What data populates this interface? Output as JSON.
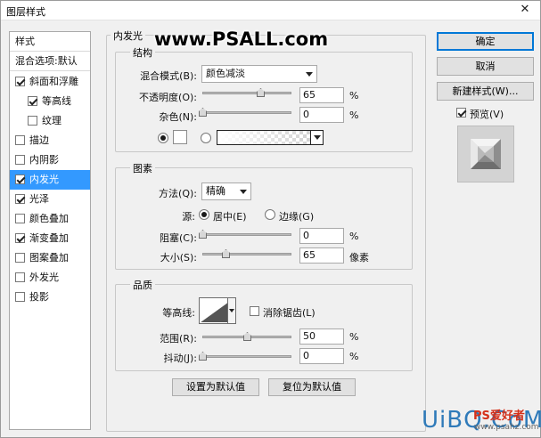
{
  "window": {
    "title": "图层样式",
    "close_glyph": "✕"
  },
  "styles_list": {
    "header": "样式",
    "blending_options": "混合选项:默认",
    "items": [
      {
        "label": "斜面和浮雕",
        "checked": true
      },
      {
        "label": "等高线",
        "checked": true
      },
      {
        "label": "纹理",
        "checked": false
      },
      {
        "label": "描边",
        "checked": false
      },
      {
        "label": "内阴影",
        "checked": false
      },
      {
        "label": "内发光",
        "checked": true,
        "selected": true
      },
      {
        "label": "光泽",
        "checked": true
      },
      {
        "label": "颜色叠加",
        "checked": false
      },
      {
        "label": "渐变叠加",
        "checked": true
      },
      {
        "label": "图案叠加",
        "checked": false
      },
      {
        "label": "外发光",
        "checked": false
      },
      {
        "label": "投影",
        "checked": false
      }
    ]
  },
  "panel": {
    "title": "内发光",
    "structure": {
      "title": "结构",
      "blend_mode_label": "混合模式(B):",
      "blend_mode_value": "颜色减淡",
      "opacity_label": "不透明度(O):",
      "opacity_value": "65",
      "opacity_unit": "%",
      "noise_label": "杂色(N):",
      "noise_value": "0",
      "noise_unit": "%"
    },
    "elements": {
      "title": "图素",
      "technique_label": "方法(Q):",
      "technique_value": "精确",
      "source_label": "源:",
      "source_center": "居中(E)",
      "source_edge": "边缘(G)",
      "choke_label": "阻塞(C):",
      "choke_value": "0",
      "choke_unit": "%",
      "size_label": "大小(S):",
      "size_value": "65",
      "size_unit": "像素"
    },
    "quality": {
      "title": "品质",
      "contour_label": "等高线:",
      "anti_alias_label": "消除锯齿(L)",
      "range_label": "范围(R):",
      "range_value": "50",
      "range_unit": "%",
      "jitter_label": "抖动(J):",
      "jitter_value": "0",
      "jitter_unit": "%"
    },
    "make_default": "设置为默认值",
    "reset_default": "复位为默认值"
  },
  "levels": {
    "opacity": 65,
    "noise": 0,
    "choke": 0,
    "size": 65,
    "size_max": 250,
    "range": 50,
    "jitter": 0
  },
  "buttons": {
    "ok": "确定",
    "cancel": "取消",
    "new_style": "新建样式(W)...",
    "preview": "预览(V)"
  },
  "watermarks": {
    "psall": "www.PSALL.com",
    "uibq": "UiBQ.CoM",
    "ps_cn": "PS爱好者",
    "ps_url": "www.psahz.com"
  },
  "colors": {
    "selection": "#3399ff",
    "button_default_border": "#0078d7"
  }
}
